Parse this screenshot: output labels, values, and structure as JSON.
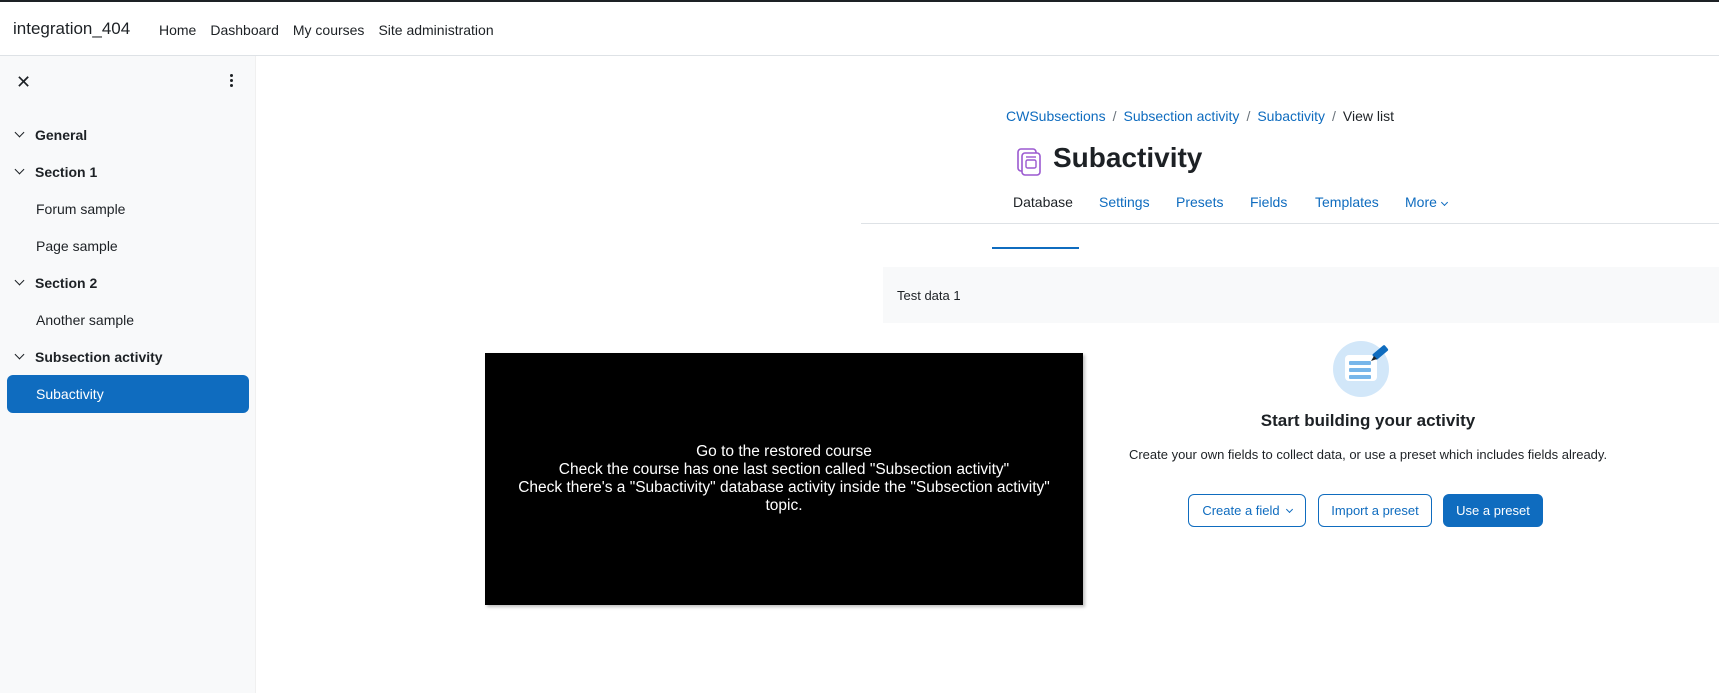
{
  "header": {
    "site_name": "integration_404",
    "nav": [
      "Home",
      "Dashboard",
      "My courses",
      "Site administration"
    ]
  },
  "drawer": {
    "close_icon": "close-icon",
    "menu_icon": "kebab-menu-icon",
    "sections": [
      {
        "label": "General",
        "items": []
      },
      {
        "label": "Section 1",
        "items": [
          "Forum sample",
          "Page sample"
        ]
      },
      {
        "label": "Section 2",
        "items": [
          "Another sample"
        ]
      },
      {
        "label": "Subsection activity",
        "items": [
          "Subactivity"
        ]
      }
    ],
    "active_item": "Subactivity"
  },
  "breadcrumb": {
    "items": [
      "CWSubsections",
      "Subsection activity",
      "Subactivity"
    ],
    "current": "View list"
  },
  "page": {
    "title": "Subactivity",
    "icon": "database-activity-icon"
  },
  "tabs": {
    "items": [
      "Database",
      "Settings",
      "Presets",
      "Fields",
      "Templates",
      "More"
    ],
    "active": "Database"
  },
  "tertiary": {
    "label": "Test data 1"
  },
  "empty_state": {
    "icon": "form-edit-icon",
    "title": "Start building your activity",
    "description": "Create your own fields to collect data, or use a preset which includes fields already.",
    "buttons": {
      "create_field": "Create a field",
      "import_preset": "Import a preset",
      "use_preset": "Use a preset"
    }
  },
  "overlay": {
    "lines": [
      "Go to the restored course",
      "Check the course has one last section called \"Subsection activity\"",
      "Check there's a \"Subactivity\" database activity inside the \"Subsection activity\" topic."
    ]
  },
  "colors": {
    "accent": "#0f6cbf",
    "text": "#1d2125",
    "drawer_bg": "#f8f9fa"
  }
}
